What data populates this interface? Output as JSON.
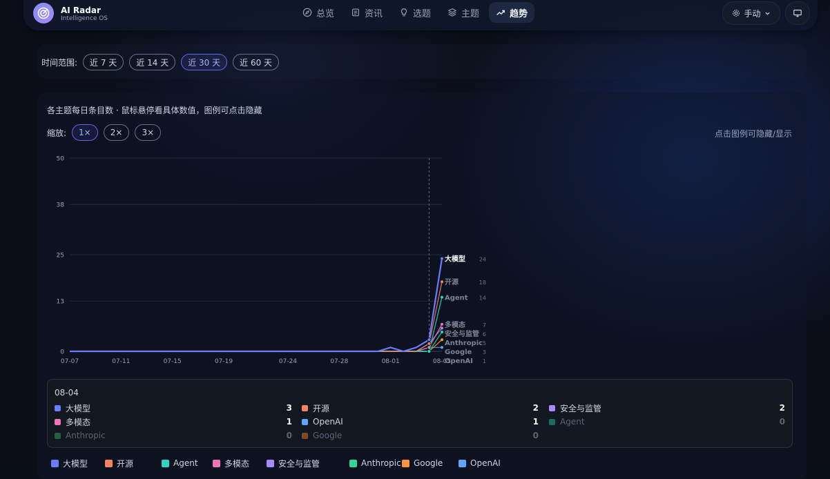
{
  "app": {
    "title": "AI Radar",
    "subtitle": "Intelligence OS"
  },
  "nav": [
    {
      "label": "总览",
      "icon": "compass-icon",
      "active": false
    },
    {
      "label": "资讯",
      "icon": "newspaper-icon",
      "active": false
    },
    {
      "label": "选题",
      "icon": "lightbulb-icon",
      "active": false
    },
    {
      "label": "主题",
      "icon": "layers-icon",
      "active": false
    },
    {
      "label": "趋势",
      "icon": "trending-up-icon",
      "active": true
    }
  ],
  "header_controls": {
    "mode_label": "手动",
    "mode_icon": "gear-icon",
    "screen_icon": "monitor-icon"
  },
  "time_range": {
    "label": "时间范围:",
    "options": [
      "近 7 天",
      "近 14 天",
      "近 30 天",
      "近 60 天"
    ],
    "selected_index": 2
  },
  "chart_panel": {
    "description": "各主题每日条目数 · 鼠标悬停看具体数值，图例可点击隐藏",
    "zoom_label": "缩放:",
    "zoom_options": [
      "1×",
      "2×",
      "3×"
    ],
    "zoom_selected_index": 0,
    "hint": "点击图例可隐藏/显示"
  },
  "chart_data": {
    "type": "line",
    "x": [
      "07-07",
      "07-08",
      "07-09",
      "07-10",
      "07-11",
      "07-12",
      "07-13",
      "07-14",
      "07-15",
      "07-16",
      "07-17",
      "07-18",
      "07-19",
      "07-20",
      "07-21",
      "07-22",
      "07-23",
      "07-24",
      "07-25",
      "07-26",
      "07-27",
      "07-28",
      "07-29",
      "07-30",
      "07-31",
      "08-01",
      "08-02",
      "08-03",
      "08-04",
      "08-05"
    ],
    "x_tick_labels": [
      "07-07",
      "07-11",
      "07-15",
      "07-19",
      "07-24",
      "07-28",
      "08-01",
      "08-05"
    ],
    "y_ticks": [
      0,
      13,
      25,
      38,
      50
    ],
    "ylim": [
      0,
      50
    ],
    "hover_x": "08-04",
    "series": [
      {
        "name": "大模型",
        "color": "#6b7cff",
        "values": [
          0,
          0,
          0,
          0,
          0,
          0,
          0,
          0,
          0,
          0,
          0,
          0,
          0,
          0,
          0,
          0,
          0,
          0,
          0,
          0,
          0,
          0,
          0,
          0,
          0,
          1,
          0,
          1,
          3,
          24
        ]
      },
      {
        "name": "开源",
        "color": "#f4845f",
        "values": [
          0,
          0,
          0,
          0,
          0,
          0,
          0,
          0,
          0,
          0,
          0,
          0,
          0,
          0,
          0,
          0,
          0,
          0,
          0,
          0,
          0,
          0,
          0,
          0,
          0,
          0,
          0,
          0,
          2,
          18
        ]
      },
      {
        "name": "Agent",
        "color": "#2dd4bf",
        "values": [
          0,
          0,
          0,
          0,
          0,
          0,
          0,
          0,
          0,
          0,
          0,
          0,
          0,
          0,
          0,
          0,
          0,
          0,
          0,
          0,
          0,
          0,
          0,
          0,
          0,
          0,
          0,
          0,
          0,
          14
        ]
      },
      {
        "name": "多模态",
        "color": "#f472b6",
        "values": [
          0,
          0,
          0,
          0,
          0,
          0,
          0,
          0,
          0,
          0,
          0,
          0,
          0,
          0,
          0,
          0,
          0,
          0,
          0,
          0,
          0,
          0,
          0,
          0,
          0,
          0,
          0,
          0,
          1,
          7
        ]
      },
      {
        "name": "安全与监管",
        "color": "#a78bfa",
        "values": [
          0,
          0,
          0,
          0,
          0,
          0,
          0,
          0,
          0,
          0,
          0,
          0,
          0,
          0,
          0,
          0,
          0,
          0,
          0,
          0,
          0,
          0,
          0,
          0,
          0,
          0,
          0,
          0,
          2,
          6
        ]
      },
      {
        "name": "Anthropic",
        "color": "#34d399",
        "values": [
          0,
          0,
          0,
          0,
          0,
          0,
          0,
          0,
          0,
          0,
          0,
          0,
          0,
          0,
          0,
          0,
          0,
          0,
          0,
          0,
          0,
          0,
          0,
          0,
          0,
          0,
          0,
          0,
          0,
          5
        ]
      },
      {
        "name": "Google",
        "color": "#fb923c",
        "values": [
          0,
          0,
          0,
          0,
          0,
          0,
          0,
          0,
          0,
          0,
          0,
          0,
          0,
          0,
          0,
          0,
          0,
          0,
          0,
          0,
          0,
          0,
          0,
          0,
          0,
          0,
          0,
          0,
          0,
          3
        ]
      },
      {
        "name": "OpenAI",
        "color": "#60a5fa",
        "values": [
          0,
          0,
          0,
          0,
          0,
          0,
          0,
          0,
          0,
          0,
          0,
          0,
          0,
          0,
          0,
          0,
          0,
          0,
          0,
          0,
          0,
          0,
          0,
          0,
          0,
          0,
          0,
          0,
          1,
          1
        ]
      }
    ]
  },
  "tooltip": {
    "date": "08-04",
    "rows": [
      {
        "name": "大模型",
        "color": "#6b7cff",
        "value": "3",
        "dim": false
      },
      {
        "name": "开源",
        "color": "#f4845f",
        "value": "2",
        "dim": false
      },
      {
        "name": "安全与监管",
        "color": "#a78bfa",
        "value": "2",
        "dim": false
      },
      {
        "name": "多模态",
        "color": "#f472b6",
        "value": "1",
        "dim": false
      },
      {
        "name": "OpenAI",
        "color": "#60a5fa",
        "value": "1",
        "dim": false
      },
      {
        "name": "Agent",
        "color": "#1c6b63",
        "value": "0",
        "dim": true
      },
      {
        "name": "Anthropic",
        "color": "#1f6148",
        "value": "0",
        "dim": true
      },
      {
        "name": "Google",
        "color": "#7c4a26",
        "value": "0",
        "dim": true
      }
    ]
  },
  "legend": [
    {
      "name": "大模型",
      "color": "#6b7cff"
    },
    {
      "name": "开源",
      "color": "#f4845f"
    },
    {
      "name": "Agent",
      "color": "#2dd4bf"
    },
    {
      "name": "多模态",
      "color": "#f472b6"
    },
    {
      "name": "安全与监管",
      "color": "#a78bfa"
    },
    {
      "name": "Anthropic",
      "color": "#34d399"
    },
    {
      "name": "Google",
      "color": "#fb923c"
    },
    {
      "name": "OpenAI",
      "color": "#60a5fa"
    }
  ]
}
